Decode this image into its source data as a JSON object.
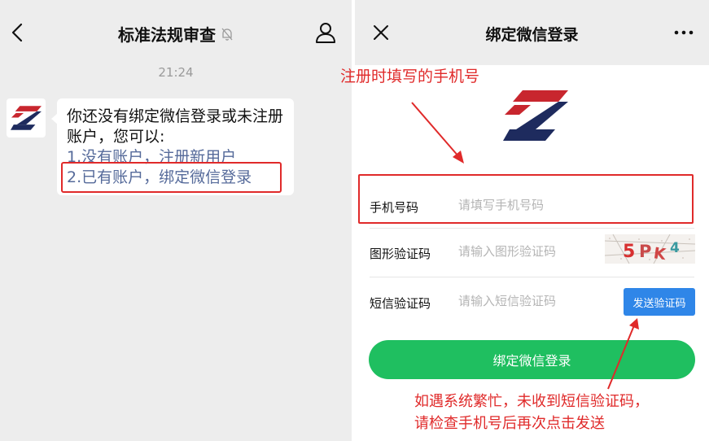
{
  "chat": {
    "title": "标准法规审查",
    "time": "21:24",
    "message_intro": "你还没有绑定微信登录或未注册账户，您可以:",
    "option_register": "1.没有账户，注册新用户",
    "option_bind": "2.已有账户，绑定微信登录"
  },
  "page": {
    "title": "绑定微信登录",
    "fields": {
      "phone_label": "手机号码",
      "phone_placeholder": "请填写手机号码",
      "captcha_label": "图形验证码",
      "captcha_placeholder": "请输入图形验证码",
      "captcha_chars": [
        "5",
        "P",
        "K",
        "4"
      ],
      "sms_label": "短信验证码",
      "sms_placeholder": "请输入短信验证码",
      "sms_button": "发送验证码"
    },
    "submit_button": "绑定微信登录"
  },
  "annotations": {
    "phone_note": "注册时填写的手机号",
    "sms_note_line1": "如遇系统繁忙，未收到短信验证码，",
    "sms_note_line2": "请检查手机号后再次点击发送"
  },
  "colors": {
    "annotation": "#e02a2a",
    "primary_green": "#1fbf60",
    "sms_button_blue": "#2f86e8",
    "link": "#556a9a",
    "logo_red": "#c8262e",
    "logo_navy": "#1e2b5e"
  },
  "icons": {
    "back": "chevron-left-icon",
    "mute": "bell-slash-icon",
    "profile": "user-icon",
    "close": "close-icon",
    "more": "more-dots-icon"
  }
}
